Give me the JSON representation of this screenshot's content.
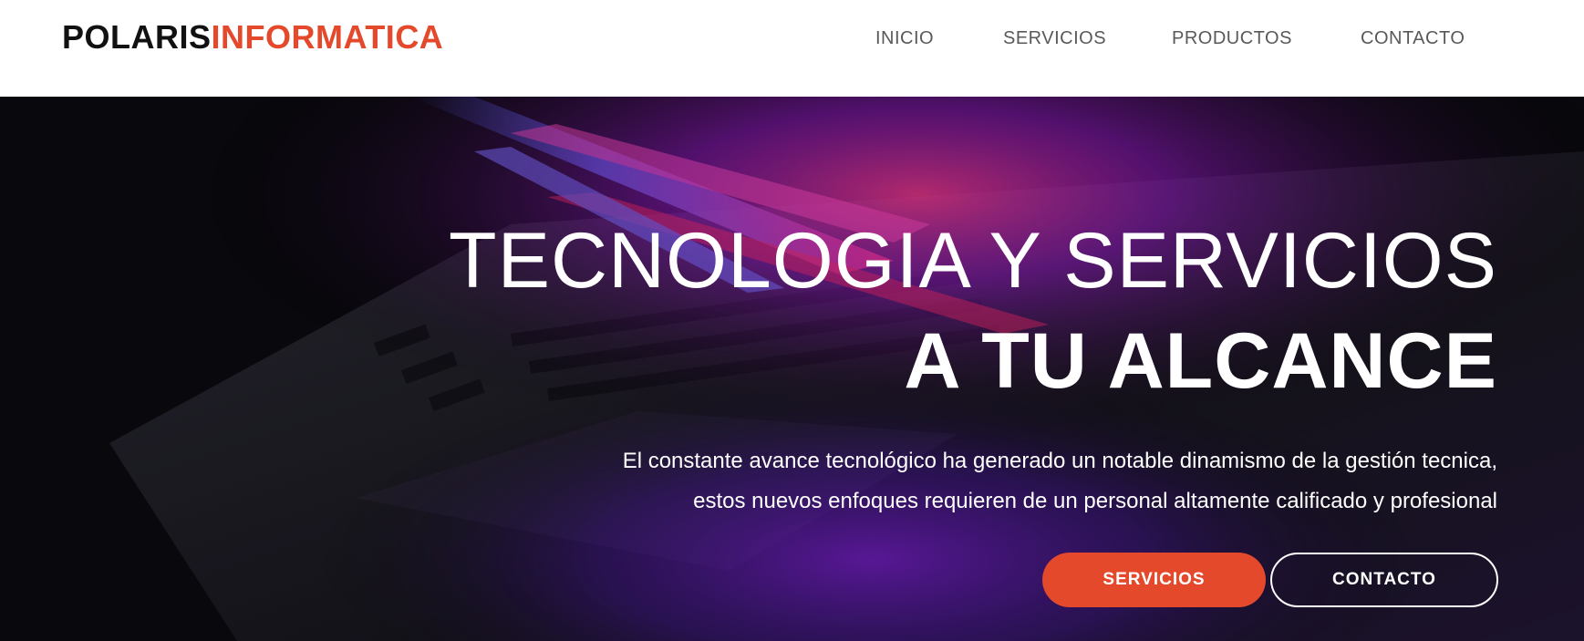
{
  "header": {
    "logo_part1": "POLARIS",
    "logo_part2": "INFORMATICA",
    "nav": [
      {
        "label": "INICIO"
      },
      {
        "label": "SERVICIOS"
      },
      {
        "label": "PRODUCTOS"
      },
      {
        "label": "CONTACTO"
      }
    ]
  },
  "hero": {
    "title_line1": "TECNOLOGIA Y SERVICIOS",
    "title_line2": "A TU ALCANCE",
    "subtitle_line1": "El constante avance tecnológico ha generado un notable dinamismo de la gestión tecnica,",
    "subtitle_line2": "estos nuevos enfoques requieren de un personal altamente calificado y profesional",
    "buttons": {
      "primary_label": "SERVICIOS",
      "secondary_label": "CONTACTO"
    },
    "background_image": "laptop-keyboard-with-purple-light-image"
  },
  "colors": {
    "accent": "#e4492c",
    "hero_bg": "#0c0b10",
    "nav_text": "#595959"
  }
}
